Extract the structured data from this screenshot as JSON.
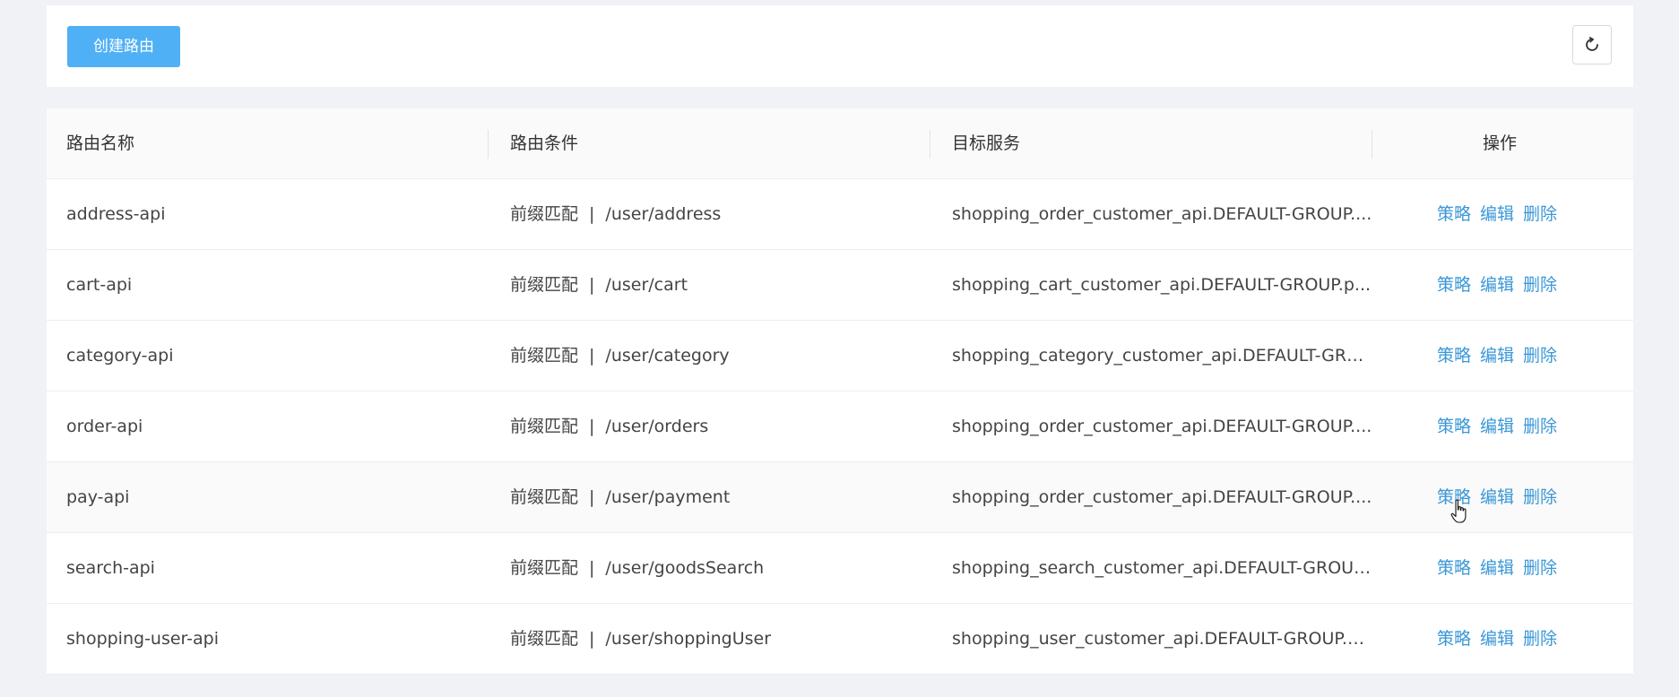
{
  "toolbar": {
    "create_label": "创建路由",
    "refresh_icon": "refresh-icon"
  },
  "table": {
    "columns": [
      "路由名称",
      "路由条件",
      "目标服务",
      "操作"
    ],
    "rows": [
      {
        "name": "address-api",
        "match_type": "前缀匹配",
        "separator": "|",
        "path": "/user/address",
        "target": "shopping_order_customer_api.DEFAULT-GROUP....",
        "ops": [
          "策略",
          "编辑",
          "删除"
        ]
      },
      {
        "name": "cart-api",
        "match_type": "前缀匹配",
        "separator": "|",
        "path": "/user/cart",
        "target": "shopping_cart_customer_api.DEFAULT-GROUP.p...",
        "ops": [
          "策略",
          "编辑",
          "删除"
        ]
      },
      {
        "name": "category-api",
        "match_type": "前缀匹配",
        "separator": "|",
        "path": "/user/category",
        "target": "shopping_category_customer_api.DEFAULT-GRO...",
        "ops": [
          "策略",
          "编辑",
          "删除"
        ]
      },
      {
        "name": "order-api",
        "match_type": "前缀匹配",
        "separator": "|",
        "path": "/user/orders",
        "target": "shopping_order_customer_api.DEFAULT-GROUP....",
        "ops": [
          "策略",
          "编辑",
          "删除"
        ]
      },
      {
        "name": "pay-api",
        "match_type": "前缀匹配",
        "separator": "|",
        "path": "/user/payment",
        "target": "shopping_order_customer_api.DEFAULT-GROUP....",
        "ops": [
          "策略",
          "编辑",
          "删除"
        ]
      },
      {
        "name": "search-api",
        "match_type": "前缀匹配",
        "separator": "|",
        "path": "/user/goodsSearch",
        "target": "shopping_search_customer_api.DEFAULT-GROUP...",
        "ops": [
          "策略",
          "编辑",
          "删除"
        ]
      },
      {
        "name": "shopping-user-api",
        "match_type": "前缀匹配",
        "separator": "|",
        "path": "/user/shoppingUser",
        "target": "shopping_user_customer_api.DEFAULT-GROUP.p...",
        "ops": [
          "策略",
          "编辑",
          "删除"
        ]
      }
    ]
  },
  "colors": {
    "primary_button": "#4fb0f5",
    "link": "#3a97d7",
    "page_bg": "#f0f2f5"
  }
}
